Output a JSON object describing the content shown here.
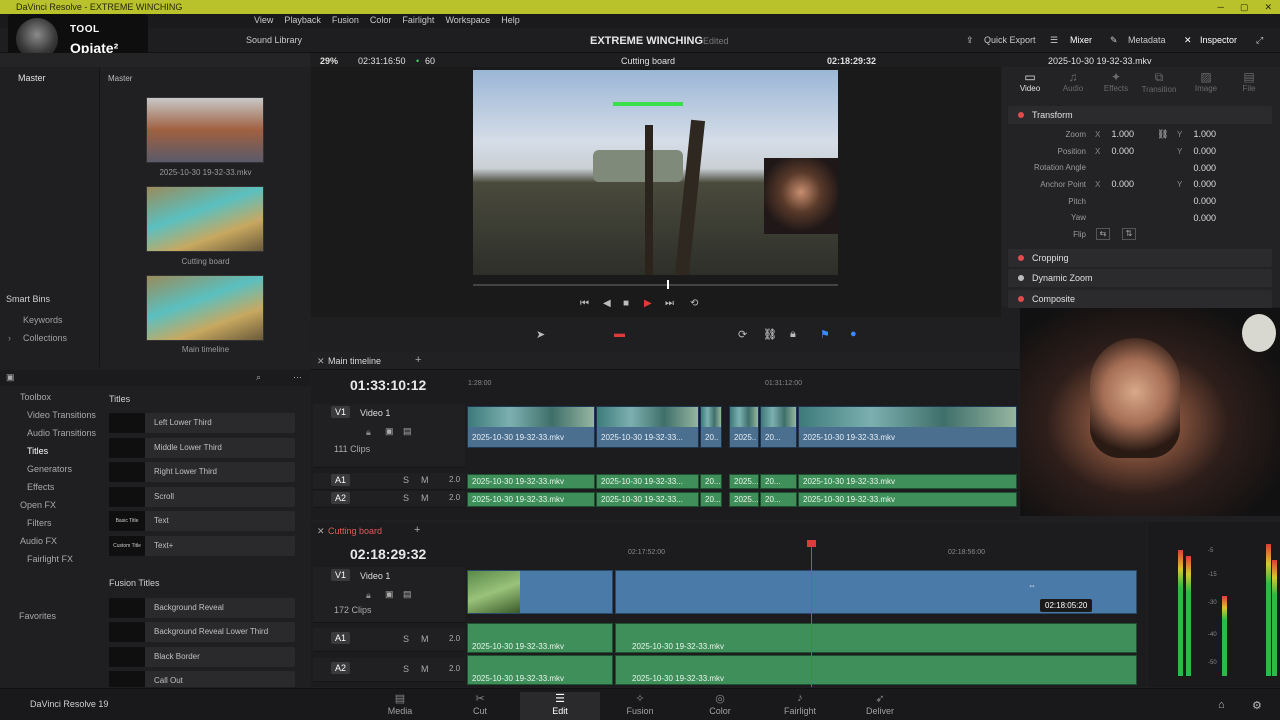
{
  "app": {
    "window_title": "DaVinci Resolve - EXTREME WINCHING",
    "version_label": "DaVinci Resolve 19"
  },
  "overlay": {
    "line1": "TOOL",
    "line2": "Opiate²"
  },
  "menu": [
    "View",
    "Playback",
    "Fusion",
    "Color",
    "Fairlight",
    "Workspace",
    "Help"
  ],
  "header": {
    "sound_library": "Sound Library",
    "project_title": "EXTREME WINCHING",
    "status": "Edited",
    "quick_export": "Quick Export",
    "mixer": "Mixer",
    "metadata": "Metadata",
    "inspector": "Inspector"
  },
  "viewer": {
    "zoom": "29%",
    "source_tc": "02:31:16:50",
    "fps": "60",
    "timeline_name": "Cutting board",
    "record_tc": "02:18:29:32",
    "clip_name": "2025-10-30 19-32-33.mkv"
  },
  "media_pool": {
    "bin_header": "Master",
    "clip_header": "Master",
    "smart_bins": "Smart Bins",
    "smart_items": [
      "Keywords",
      "Collections"
    ],
    "clips": [
      {
        "label": "2025-10-30 19-32-33.mkv"
      },
      {
        "label": "Cutting board"
      },
      {
        "label": "Main timeline"
      }
    ]
  },
  "toolbox": {
    "categories": [
      "Toolbox",
      "Video Transitions",
      "Audio Transitions",
      "Titles",
      "Generators",
      "Effects",
      "Open FX",
      "Filters",
      "Audio FX",
      "Fairlight FX"
    ],
    "favorites": "Favorites",
    "titles_header": "Titles",
    "titles": [
      {
        "swatch": "",
        "name": "Left Lower Third"
      },
      {
        "swatch": "",
        "name": "Middle Lower Third"
      },
      {
        "swatch": "",
        "name": "Right Lower Third"
      },
      {
        "swatch": "",
        "name": "Scroll"
      },
      {
        "swatch": "Basic Title",
        "name": "Text"
      },
      {
        "swatch": "Custom Title",
        "name": "Text+"
      }
    ],
    "fusion_header": "Fusion Titles",
    "fusion_titles": [
      {
        "name": "Background Reveal"
      },
      {
        "name": "Background Reveal Lower Third"
      },
      {
        "name": "Black Border"
      },
      {
        "name": "Call Out"
      }
    ]
  },
  "inspector": {
    "tabs": [
      "Video",
      "Audio",
      "Effects",
      "Transition",
      "Image",
      "File"
    ],
    "active_tab": "Video",
    "sections": [
      "Transform",
      "Cropping",
      "Dynamic Zoom",
      "Composite"
    ],
    "transform": {
      "zoom_label": "Zoom",
      "zoom_x": "1.000",
      "zoom_y": "1.000",
      "position_label": "Position",
      "position_x": "0.000",
      "position_y": "0.000",
      "rotation_label": "Rotation Angle",
      "rotation": "0.000",
      "anchor_label": "Anchor Point",
      "anchor_x": "0.000",
      "anchor_y": "0.000",
      "pitch_label": "Pitch",
      "pitch": "0.000",
      "yaw_label": "Yaw",
      "yaw": "0.000",
      "flip_label": "Flip",
      "x_axis": "X",
      "y_axis": "Y"
    }
  },
  "timeline1": {
    "tab": "Main timeline",
    "timecode": "01:33:10:12",
    "ruler": [
      "1:28:00",
      "01:31:12:00"
    ],
    "video_track": {
      "tag": "V1",
      "name": "Video 1",
      "count": "111 Clips"
    },
    "audio_tracks": [
      {
        "tag": "A1",
        "level": "2.0"
      },
      {
        "tag": "A2",
        "level": "2.0"
      }
    ],
    "video_clips": [
      "2025-10-30 19-32-33.mkv",
      "2025-10-30 19-32-33...",
      "20...",
      "2025...",
      "20...",
      "2025-10-30 19-32-33.mkv"
    ],
    "audio_clips": [
      "2025-10-30 19-32-33.mkv",
      "2025-10-30 19-32-33...",
      "20...",
      "2025...",
      "20...",
      "2025-10-30 19-32-33.mkv"
    ]
  },
  "timeline2": {
    "tab": "Cutting board",
    "timecode": "02:18:29:32",
    "ruler": [
      "02:17:52:00",
      "02:18:56:00"
    ],
    "tooltip": "02:18:05:20",
    "video_track": {
      "tag": "V1",
      "name": "Video 1",
      "count": "172 Clips"
    },
    "audio_tracks": [
      {
        "tag": "A1",
        "level": "2.0",
        "clips": [
          "2025-10-30 19-32-33.mkv",
          "2025-10-30 19-32-33.mkv"
        ]
      },
      {
        "tag": "A2",
        "level": "2.0",
        "clips": [
          "2025-10-30 19-32-33.mkv",
          "2025-10-30 19-32-33.mkv"
        ]
      }
    ]
  },
  "track_buttons": {
    "solo": "S",
    "mute": "M"
  },
  "meters": {
    "scale": [
      "-5",
      "-10",
      "-15",
      "-20",
      "-30",
      "-40",
      "-50"
    ]
  },
  "pages": [
    "Media",
    "Cut",
    "Edit",
    "Fusion",
    "Color",
    "Fairlight",
    "Deliver"
  ],
  "active_page": "Edit",
  "colors": {
    "title_bar": "#b9c22a",
    "clip_video": "#4a6f8f",
    "clip_audio": "#3f8f5a",
    "playhead": "#e03b3b",
    "accent_red": "#e24c4c"
  }
}
